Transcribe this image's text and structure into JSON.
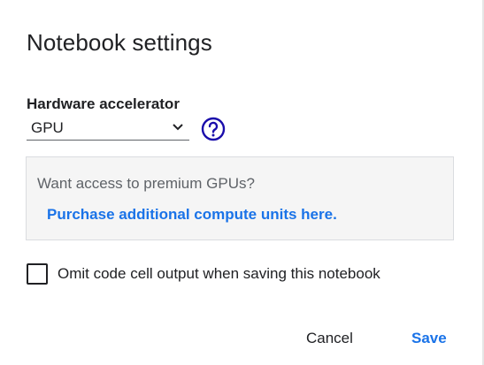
{
  "dialog": {
    "title": "Notebook settings"
  },
  "hardware": {
    "label": "Hardware accelerator",
    "selected": "GPU",
    "help_icon": "question-circle-icon",
    "help_color": "#1a0dab"
  },
  "promo": {
    "text": "Want access to premium GPUs?",
    "link": "Purchase additional compute units here."
  },
  "omit_output": {
    "label": "Omit code cell output when saving this notebook",
    "checked": false
  },
  "actions": {
    "cancel": "Cancel",
    "save": "Save"
  },
  "colors": {
    "accent": "#1a73e8",
    "text": "#202124",
    "muted": "#5f6368",
    "panel": "#f5f5f5"
  }
}
